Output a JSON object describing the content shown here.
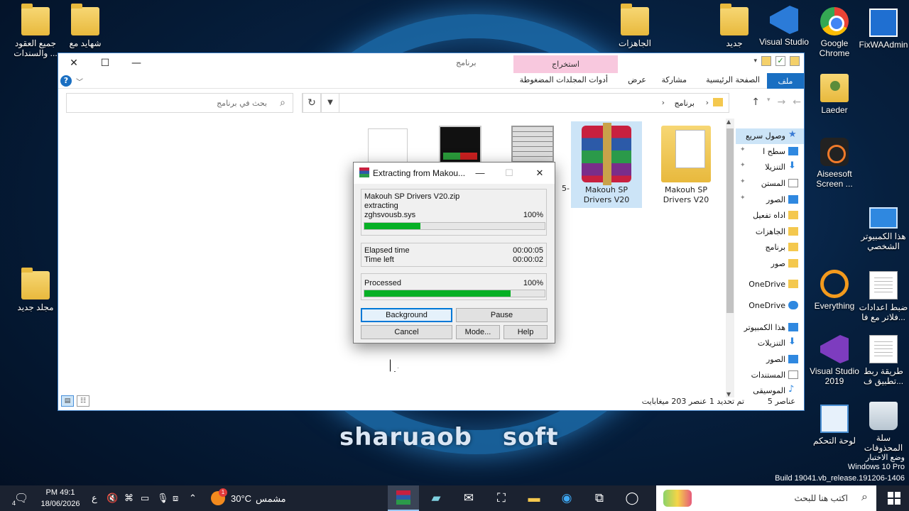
{
  "desktop": {
    "left_icons": [
      {
        "label": "جميع العقود والسندات ...",
        "icon": "document-folder-icon"
      },
      {
        "label": "شهايد مع",
        "icon": "folder-icon"
      },
      {
        "label": "مجلد جديد",
        "icon": "folder-icon"
      }
    ],
    "top_icons": [
      {
        "label": "الجاهزات",
        "icon": "folder-icon"
      },
      {
        "label": "جديد",
        "icon": "folder-icon"
      },
      {
        "label": "Visual Studio",
        "icon": "visual-studio-icon"
      },
      {
        "label": "Google Chrome",
        "icon": "chrome-icon"
      },
      {
        "label": "FixWAAdmin",
        "icon": "app-window-icon"
      }
    ],
    "right_icons": [
      {
        "label": "Laeder",
        "icon": "user-folder-icon"
      },
      {
        "label": "Aiseesoft Screen ...",
        "icon": "screen-recorder-icon"
      },
      {
        "label": "هذا الكمبيوتر الشخصي",
        "icon": "this-pc-icon"
      },
      {
        "label": "Everything",
        "icon": "everything-icon"
      },
      {
        "label": "ضبط اعدادات فلاتر مع فا...",
        "icon": "document-icon"
      },
      {
        "label": "Visual Studio 2019",
        "icon": "visual-studio-2019-icon"
      },
      {
        "label": "طريقة ربط تطبيق ف...",
        "icon": "document-icon"
      },
      {
        "label": "لوحة التحكم",
        "icon": "control-panel-icon"
      },
      {
        "label": "سلة المحذوفات",
        "icon": "recycle-bin-icon"
      }
    ],
    "watermark_text": "sharuaob soft",
    "build_info": {
      "line1": "وضع الاختبار",
      "line2": "Windows 10 Pro",
      "line3": "Build 19041.vb_release.191206-1406"
    }
  },
  "explorer": {
    "window_name": "برنامج",
    "ribbon_context_tab": "استخراج",
    "menu": {
      "file": "ملف",
      "home": "الصفحة الرئيسية",
      "share": "مشاركة",
      "view": "عرض",
      "compressed_tools": "أدوات المجلدات المضغوطة"
    },
    "address": {
      "path": "برنامج",
      "search_placeholder": "بحث في برنامج"
    },
    "nav_pane": [
      {
        "label": "وصول سريع",
        "icon": "star-icon",
        "selected": true
      },
      {
        "label": "سطح ا",
        "icon": "desktop-icon",
        "pinned": true
      },
      {
        "label": "التنزيلا",
        "icon": "download-icon",
        "pinned": true
      },
      {
        "label": "المستن",
        "icon": "documents-icon",
        "pinned": true
      },
      {
        "label": "الصور",
        "icon": "pictures-icon",
        "pinned": true
      },
      {
        "label": "اداه تفعيل",
        "icon": "folder-icon"
      },
      {
        "label": "الجاهزات",
        "icon": "folder-icon"
      },
      {
        "label": "برنامج",
        "icon": "folder-icon"
      },
      {
        "label": "صور",
        "icon": "folder-icon"
      },
      {
        "label": "OneDrive",
        "icon": "folder-icon"
      },
      {
        "label": "OneDrive",
        "icon": "onedrive-icon"
      },
      {
        "label": "هذا الكمبيوتر",
        "icon": "this-pc-icon"
      },
      {
        "label": "التنزيلات",
        "icon": "download-icon"
      },
      {
        "label": "الصور",
        "icon": "pictures-icon"
      },
      {
        "label": "المستندات",
        "icon": "documents-icon"
      },
      {
        "label": "الموسيقى",
        "icon": "music-icon"
      }
    ],
    "files": [
      {
        "name": "Makouh SP Drivers V20",
        "type": "folder"
      },
      {
        "name": "Makouh SP Drivers V20",
        "type": "rar-archive",
        "selected": true
      },
      {
        "name": "5-",
        "type": "image-table"
      },
      {
        "name": "",
        "type": "image-screenshot"
      },
      {
        "name": "",
        "type": "blank-document"
      }
    ],
    "status": {
      "count": "5 عناصر",
      "selection": "تم تحديد 1 عنصر  203 ميغابايت"
    }
  },
  "dialog": {
    "title": "Extracting from Makou...",
    "archive": "Makouh SP Drivers V20.zip",
    "action": "extracting",
    "current_file": "zghsvousb.sys",
    "file_percent_label": "100%",
    "file_progress": 0.31,
    "elapsed_label": "Elapsed time",
    "elapsed_value": "00:00:05",
    "time_left_label": "Time left",
    "time_left_value": "00:00:02",
    "processed_label": "Processed",
    "processed_percent_label": "100%",
    "processed_progress": 0.81,
    "buttons": {
      "background": "Background",
      "pause": "Pause",
      "cancel": "Cancel",
      "mode": "Mode...",
      "help": "Help"
    }
  },
  "taskbar": {
    "search_placeholder": "اكتب هنا للبحث",
    "weather_temp": "30°C",
    "weather_desc": "مشمس",
    "notification_count": "1",
    "clock_time": "PM 49:1",
    "clock_date": "18/06/2026",
    "input_lang": "ع",
    "tray_badge": "4"
  }
}
